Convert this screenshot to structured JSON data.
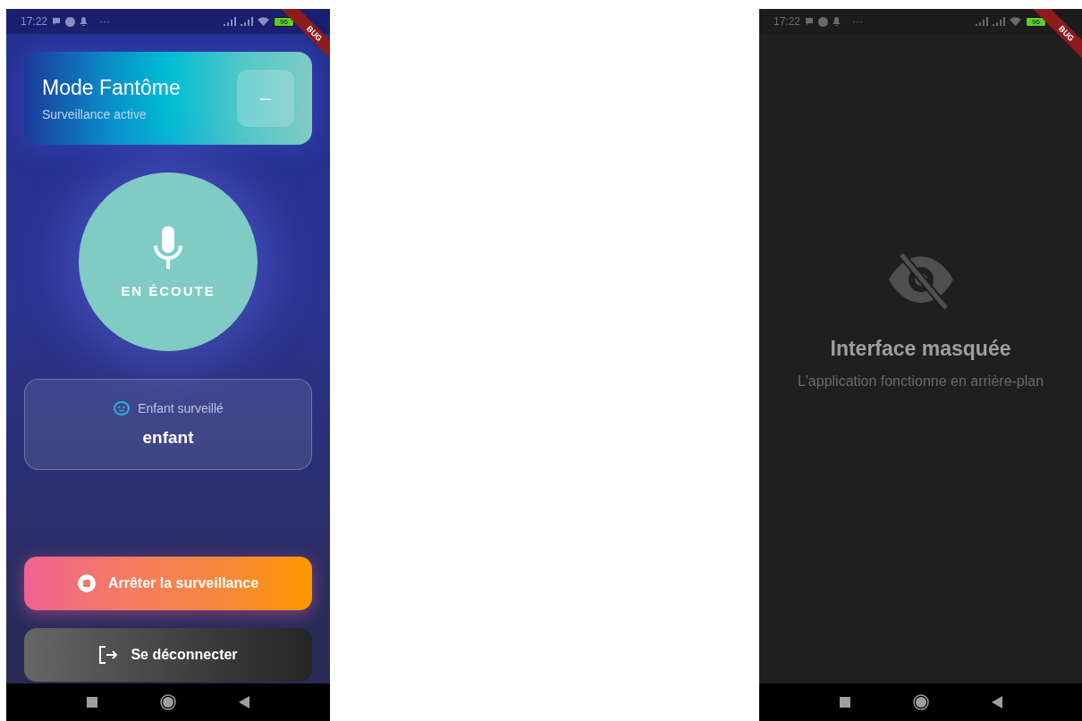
{
  "left_screen": {
    "status_bar": {
      "time": "17:22",
      "more": "···",
      "battery": "96",
      "banner": "BUG"
    },
    "header": {
      "title": "Mode Fantôme",
      "subtitle": "Surveillance active",
      "minimize_label": "–"
    },
    "listening": {
      "label": "EN ÉCOUTE"
    },
    "child_card": {
      "label": "Enfant surveillé",
      "name": "enfant"
    },
    "buttons": [
      {
        "kind": "stop",
        "label": "Arrêter la surveillance"
      },
      {
        "kind": "logout",
        "label": "Se déconnecter"
      }
    ]
  },
  "right_screen": {
    "status_bar": {
      "time": "17:22",
      "more": "···",
      "battery": "96",
      "banner": "BUG"
    },
    "title": "Interface masquée",
    "subtitle": "L'application fonctionne en arrière-plan"
  }
}
